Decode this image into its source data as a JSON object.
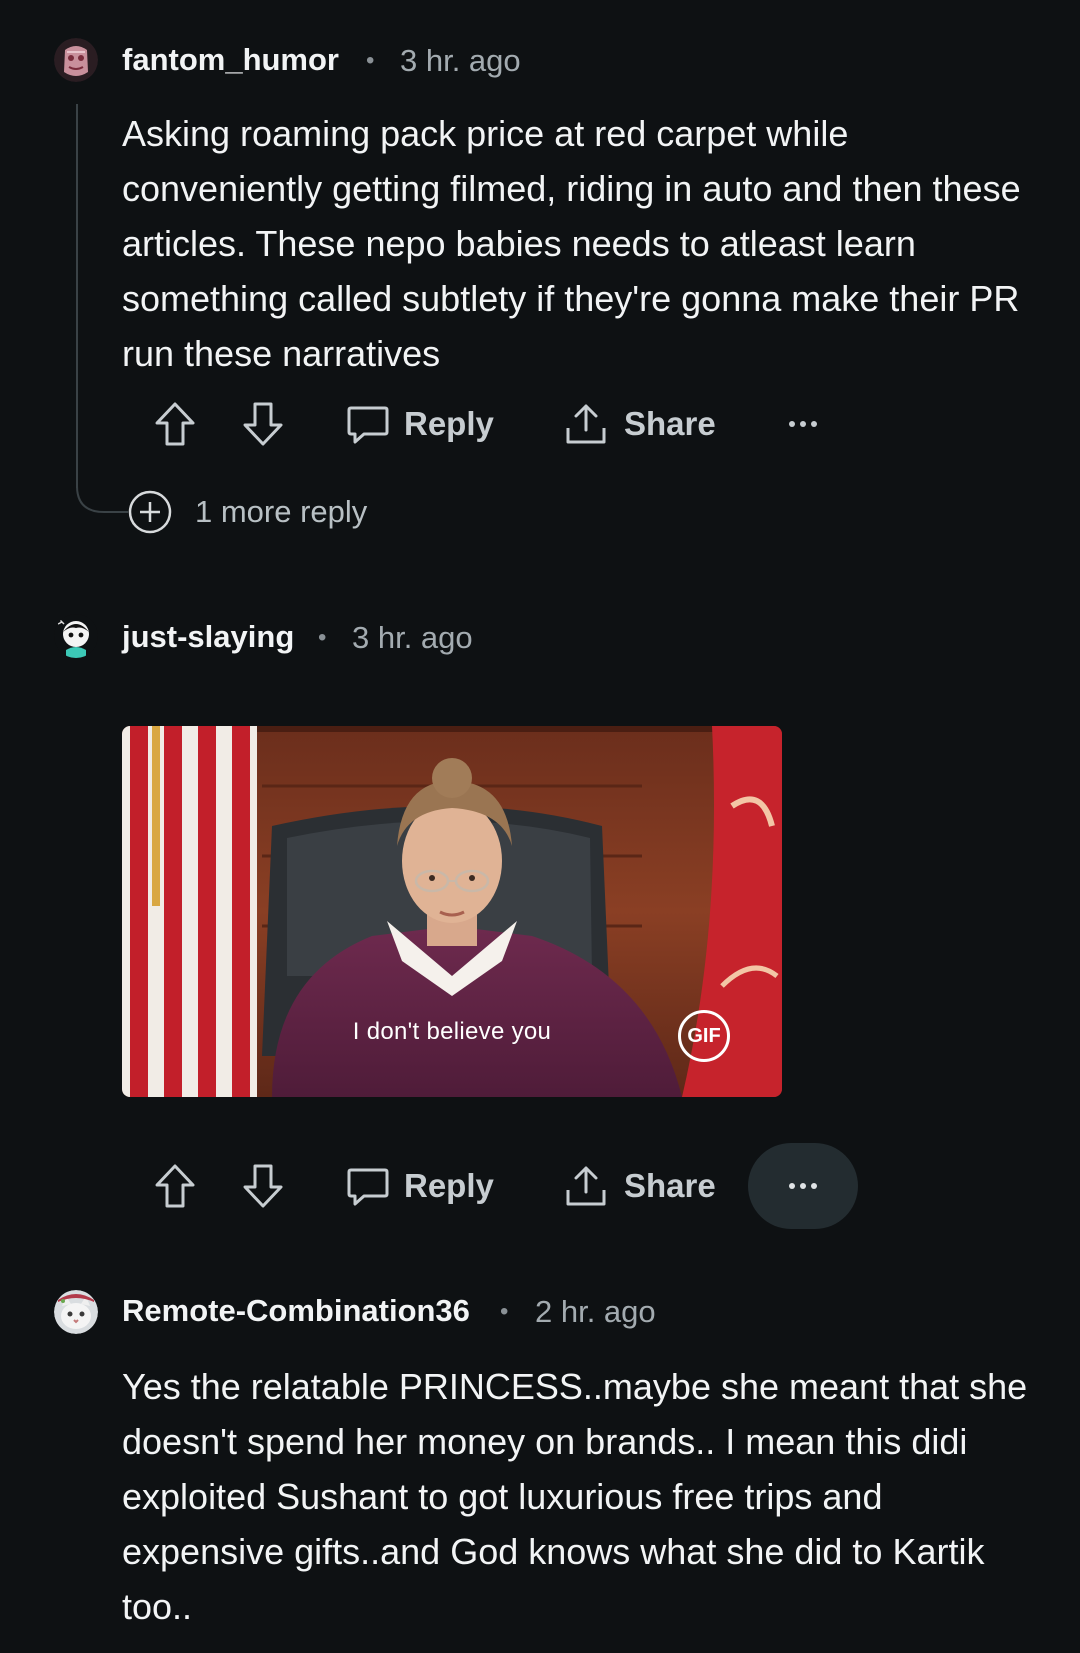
{
  "comments": [
    {
      "username": "fantom_humor",
      "time": "3 hr. ago",
      "text": "Asking roaming pack price at red carpet while conveniently getting filmed, riding in auto and then these articles. These nepo babies needs to atleast learn something called subtlety if they're gonna make their PR run these narratives",
      "reply_label": "Reply",
      "share_label": "Share",
      "more_replies": "1 more reply"
    },
    {
      "username": "just-slaying",
      "time": "3 hr. ago",
      "gif_caption": "I don't believe you",
      "gif_badge": "GIF",
      "reply_label": "Reply",
      "share_label": "Share"
    },
    {
      "username": "Remote-Combination36",
      "time": "2 hr. ago",
      "text": "Yes the relatable PRINCESS..maybe she meant that she doesn't spend her money on brands.. I mean this didi exploited Sushant to got luxurious free trips and expensive gifts..and God knows what she did to Kartik too.."
    }
  ],
  "separator": "•",
  "colors": {
    "background": "#0e1113",
    "text": "#f2f4f5",
    "muted": "#a3abb0",
    "more_button_active": "#232c30"
  },
  "icons": [
    "upvote-icon",
    "downvote-icon",
    "comment-icon",
    "share-icon",
    "more-icon",
    "plus-circle-icon"
  ]
}
